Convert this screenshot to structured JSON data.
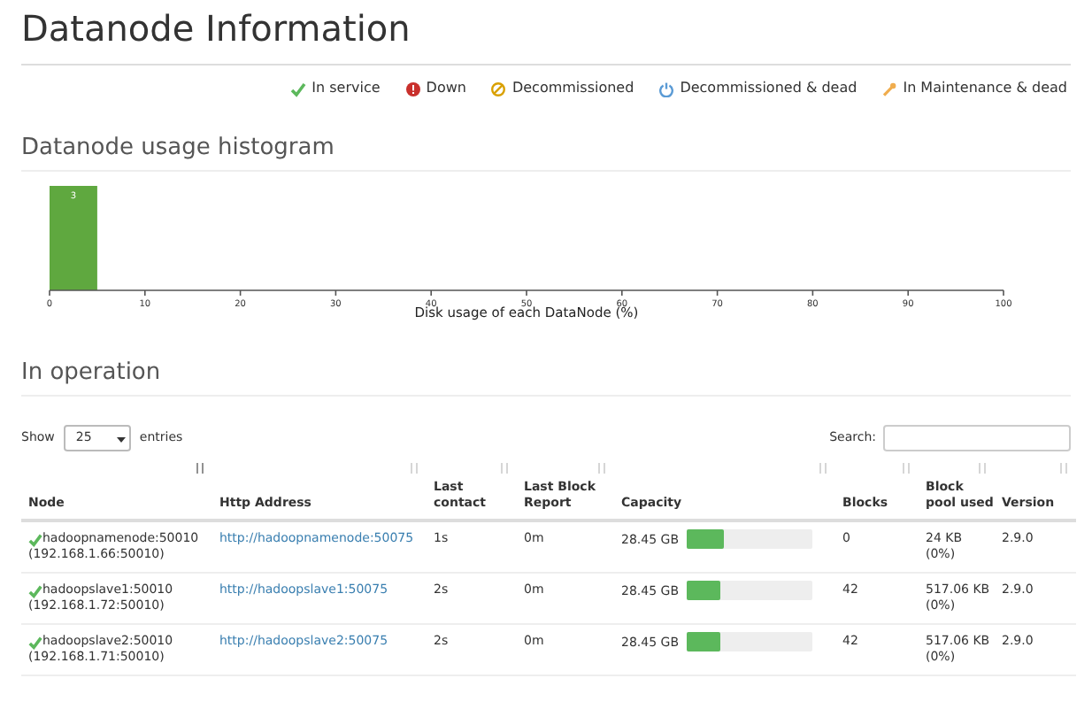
{
  "page_title": "Datanode Information",
  "legend": [
    {
      "kind": "in_service",
      "label": "In service"
    },
    {
      "kind": "down",
      "label": "Down"
    },
    {
      "kind": "decommissioned",
      "label": "Decommissioned"
    },
    {
      "kind": "decommissioned_dead",
      "label": "Decommissioned & dead"
    },
    {
      "kind": "maintenance_dead",
      "label": "In Maintenance & dead"
    }
  ],
  "histogram": {
    "heading": "Datanode usage histogram",
    "chart_data": {
      "type": "bar",
      "xlabel": "Disk usage of each DataNode (%)",
      "x": [
        2.5
      ],
      "values": [
        3
      ],
      "xlim": [
        0,
        100
      ],
      "xticks": [
        0,
        10,
        20,
        30,
        40,
        50,
        60,
        70,
        80,
        90,
        100
      ],
      "data_labels": true
    }
  },
  "operation": {
    "heading": "In operation",
    "show_label": "Show",
    "page_size": "25",
    "entries_label": "entries",
    "search_label": "Search:",
    "columns": [
      {
        "label": "Node",
        "sorted": true
      },
      {
        "label": "Http Address",
        "sorted": false
      },
      {
        "label": "Last contact",
        "sorted": false
      },
      {
        "label": "Last Block Report",
        "sorted": false
      },
      {
        "label": "Capacity",
        "sorted": false
      },
      {
        "label": "Blocks",
        "sorted": false
      },
      {
        "label": "Block pool used",
        "sorted": false
      },
      {
        "label": "Version",
        "sorted": false
      }
    ],
    "rows": [
      {
        "node": "hadoopnamenode:50010",
        "ip": "(192.168.1.66:50010)",
        "http": "http://hadoopnamenode:50075",
        "last_contact": "1s",
        "last_block_report": "0m",
        "capacity": "28.45 GB",
        "level": 0.3,
        "blocks": "0",
        "pool_used": "24 KB",
        "pool_pct": "(0%)",
        "version": "2.9.0"
      },
      {
        "node": "hadoopslave1:50010",
        "ip": "(192.168.1.72:50010)",
        "http": "http://hadoopslave1:50075",
        "last_contact": "2s",
        "last_block_report": "0m",
        "capacity": "28.45 GB",
        "level": 0.28,
        "blocks": "42",
        "pool_used": "517.06 KB",
        "pool_pct": "(0%)",
        "version": "2.9.0"
      },
      {
        "node": "hadoopslave2:50010",
        "ip": "(192.168.1.71:50010)",
        "http": "http://hadoopslave2:50075",
        "last_contact": "2s",
        "last_block_report": "0m",
        "capacity": "28.45 GB",
        "level": 0.27,
        "blocks": "42",
        "pool_used": "517.06 KB",
        "pool_pct": "(0%)",
        "version": "2.9.0"
      }
    ]
  }
}
